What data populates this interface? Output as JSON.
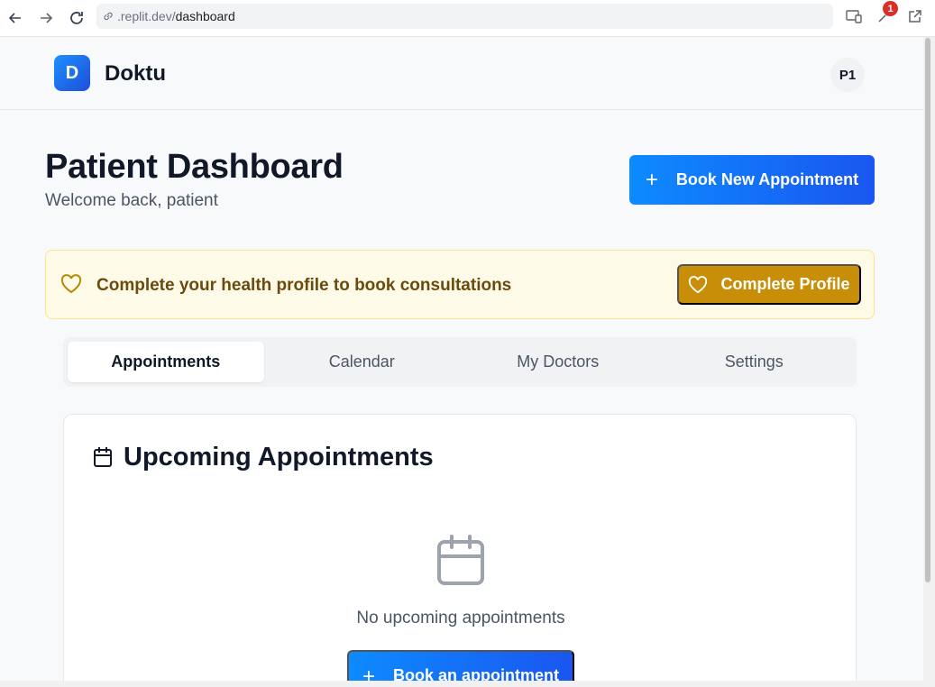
{
  "browser": {
    "url_prefix": ".replit.dev/",
    "url_path": "dashboard",
    "notification_count": "1"
  },
  "header": {
    "logo_letter": "D",
    "brand": "Doktu",
    "avatar_initials": "P1"
  },
  "page": {
    "title": "Patient Dashboard",
    "subtitle": "Welcome back, patient",
    "book_button_label": "Book New Appointment"
  },
  "alert": {
    "message": "Complete your health profile to book consultations",
    "button_label": "Complete Profile"
  },
  "tabs": [
    {
      "label": "Appointments",
      "active": true
    },
    {
      "label": "Calendar",
      "active": false
    },
    {
      "label": "My Doctors",
      "active": false
    },
    {
      "label": "Settings",
      "active": false
    }
  ],
  "card": {
    "title": "Upcoming Appointments",
    "empty_message": "No upcoming appointments",
    "button_label": "Book an appointment"
  },
  "icons": {
    "back": "arrow-left-icon",
    "forward": "arrow-right-icon",
    "reload": "reload-icon",
    "link": "link-icon",
    "cast": "screen-cast-icon",
    "extension": "extension-icon",
    "open": "open-external-icon",
    "heart": "heart-icon",
    "calendar": "calendar-icon",
    "plus": "plus-icon"
  },
  "colors": {
    "primary": "#0d8bff",
    "primary_end": "#1a56f0",
    "warning_bg": "#fefae8",
    "warning_border": "#fbe58a",
    "warning_button": "#c98e07",
    "warning_text": "#6b4a0e"
  }
}
